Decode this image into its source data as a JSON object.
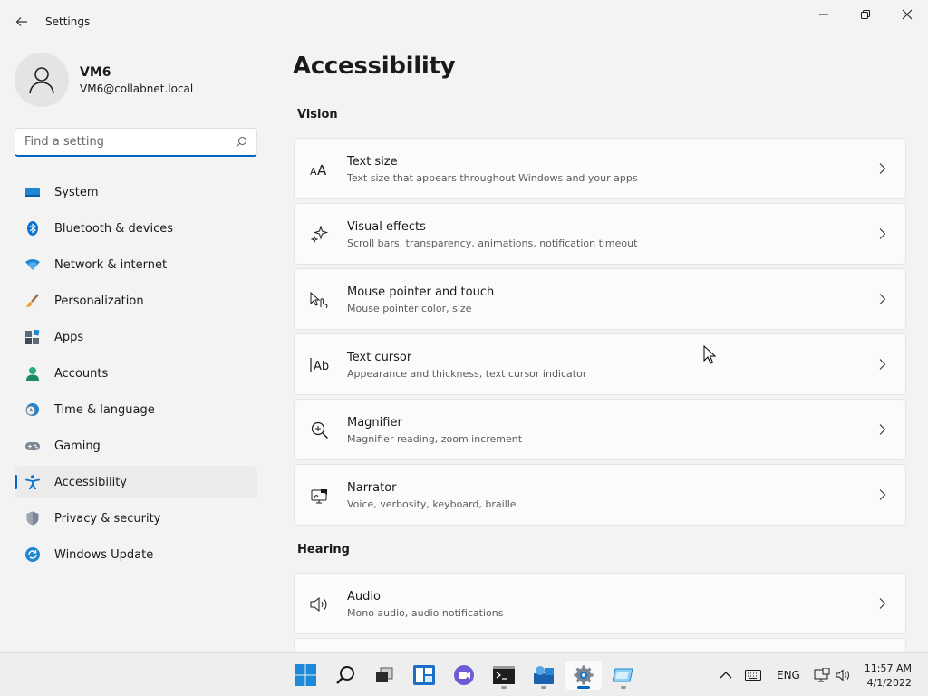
{
  "window": {
    "title": "Settings"
  },
  "user": {
    "name": "VM6",
    "email": "VM6@collabnet.local"
  },
  "search": {
    "placeholder": "Find a setting"
  },
  "sidebar": {
    "items": [
      {
        "label": "System",
        "icon": "system-icon"
      },
      {
        "label": "Bluetooth & devices",
        "icon": "bluetooth-icon"
      },
      {
        "label": "Network & internet",
        "icon": "network-icon"
      },
      {
        "label": "Personalization",
        "icon": "brush-icon"
      },
      {
        "label": "Apps",
        "icon": "apps-icon"
      },
      {
        "label": "Accounts",
        "icon": "accounts-icon"
      },
      {
        "label": "Time & language",
        "icon": "clock-icon"
      },
      {
        "label": "Gaming",
        "icon": "gamepad-icon"
      },
      {
        "label": "Accessibility",
        "icon": "accessibility-icon",
        "active": true
      },
      {
        "label": "Privacy & security",
        "icon": "shield-icon"
      },
      {
        "label": "Windows Update",
        "icon": "update-icon"
      }
    ]
  },
  "main": {
    "title": "Accessibility",
    "sections": [
      {
        "title": "Vision",
        "items": [
          {
            "title": "Text size",
            "desc": "Text size that appears throughout Windows and your apps",
            "icon": "text-size-icon"
          },
          {
            "title": "Visual effects",
            "desc": "Scroll bars, transparency, animations, notification timeout",
            "icon": "sparkle-icon"
          },
          {
            "title": "Mouse pointer and touch",
            "desc": "Mouse pointer color, size",
            "icon": "pointer-touch-icon"
          },
          {
            "title": "Text cursor",
            "desc": "Appearance and thickness, text cursor indicator",
            "icon": "text-cursor-icon"
          },
          {
            "title": "Magnifier",
            "desc": "Magnifier reading, zoom increment",
            "icon": "magnifier-icon"
          },
          {
            "title": "Narrator",
            "desc": "Voice, verbosity, keyboard, braille",
            "icon": "narrator-icon"
          }
        ]
      },
      {
        "title": "Hearing",
        "items": [
          {
            "title": "Audio",
            "desc": "Mono audio, audio notifications",
            "icon": "speaker-icon"
          }
        ]
      }
    ]
  },
  "taskbar": {
    "language": "ENG",
    "time": "11:57 AM",
    "date": "4/1/2022"
  },
  "colors": {
    "accent": "#0067c0",
    "background": "#f3f3f3",
    "card": "#fbfbfb"
  }
}
